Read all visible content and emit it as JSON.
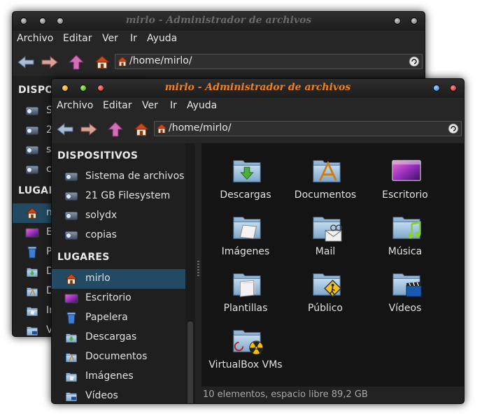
{
  "window_title": "mirlo - Administrador de archivos",
  "menu": [
    "Archivo",
    "Editar",
    "Ver",
    "Ir",
    "Ayuda"
  ],
  "location": "/home/mirlo/",
  "sidebar": {
    "devices_header": "DISPOSITIVOS",
    "devices": [
      {
        "label": "Sistema de archivos",
        "icon": "filesystem-icon"
      },
      {
        "label": "21 GB Filesystem",
        "icon": "drive-icon"
      },
      {
        "label": "solydx",
        "icon": "drive-icon"
      },
      {
        "label": "copias",
        "icon": "drive-icon"
      }
    ],
    "places_header": "LUGARES",
    "places": [
      {
        "label": "mirlo",
        "icon": "home-icon",
        "selected": true
      },
      {
        "label": "Escritorio",
        "icon": "desktop-icon"
      },
      {
        "label": "Papelera",
        "icon": "trash-icon"
      },
      {
        "label": "Descargas",
        "icon": "downloads-folder-icon"
      },
      {
        "label": "Documentos",
        "icon": "documents-folder-icon"
      },
      {
        "label": "Imágenes",
        "icon": "pictures-folder-icon"
      },
      {
        "label": "Vídeos",
        "icon": "videos-folder-icon"
      }
    ]
  },
  "files": [
    {
      "label": "Descargas",
      "icon": "downloads-folder-icon"
    },
    {
      "label": "Documentos",
      "icon": "documents-folder-icon"
    },
    {
      "label": "Escritorio",
      "icon": "desktop-icon"
    },
    {
      "label": "Imágenes",
      "icon": "pictures-folder-icon"
    },
    {
      "label": "Mail",
      "icon": "mail-folder-icon"
    },
    {
      "label": "Música",
      "icon": "music-folder-icon"
    },
    {
      "label": "Plantillas",
      "icon": "templates-folder-icon"
    },
    {
      "label": "Público",
      "icon": "public-folder-icon"
    },
    {
      "label": "Vídeos",
      "icon": "videos-folder-icon"
    },
    {
      "label": "VirtualBox VMs",
      "icon": "virtualbox-folder-icon"
    }
  ],
  "back_window": {
    "devices_header_partial": "DISPO",
    "places_header_partial": "LUGAR",
    "device_labels_partial": [
      "S",
      "2",
      "s",
      "c"
    ],
    "place_labels_partial": [
      "m",
      "E",
      "P",
      "D",
      "D",
      "Ir",
      "V"
    ]
  },
  "status": "10 elementos, espacio libre 89,2 GB",
  "colors": {
    "title_active": "#f08020",
    "title_inactive": "#6a6a6a",
    "selection": "#234a63",
    "background": "#141414"
  }
}
